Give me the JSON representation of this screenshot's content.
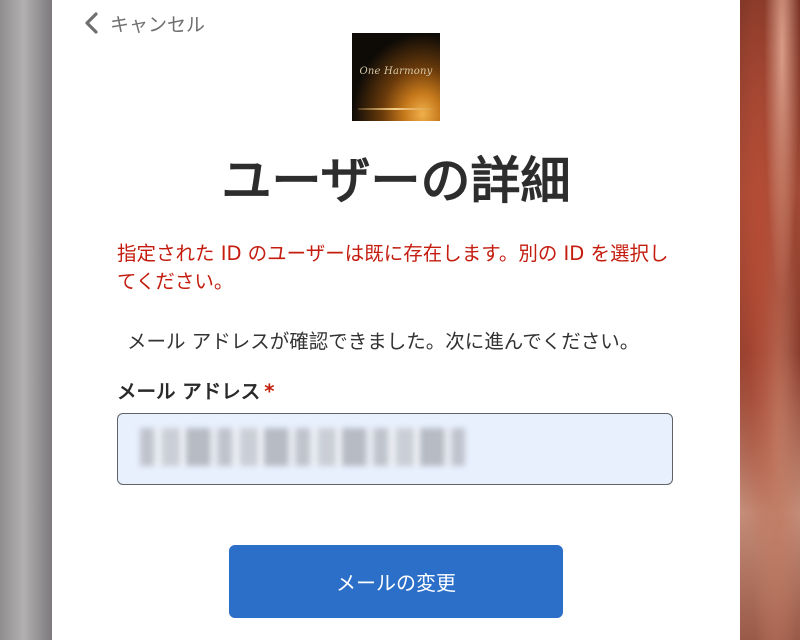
{
  "nav": {
    "cancel_label": "キャンセル"
  },
  "logo": {
    "text": "One Harmony"
  },
  "page": {
    "title": "ユーザーの詳細"
  },
  "messages": {
    "error": "指定された ID のユーザーは既に存在します。別の ID を選択してください。",
    "info": "メール アドレスが確認できました。次に進んでください。"
  },
  "form": {
    "email_label": "メール アドレス",
    "required_mark": "*",
    "email_value": ""
  },
  "actions": {
    "change_email_label": "メールの変更"
  },
  "colors": {
    "error": "#c41d0f",
    "button": "#2b6fc9",
    "input_bg": "#e8f0fe"
  }
}
